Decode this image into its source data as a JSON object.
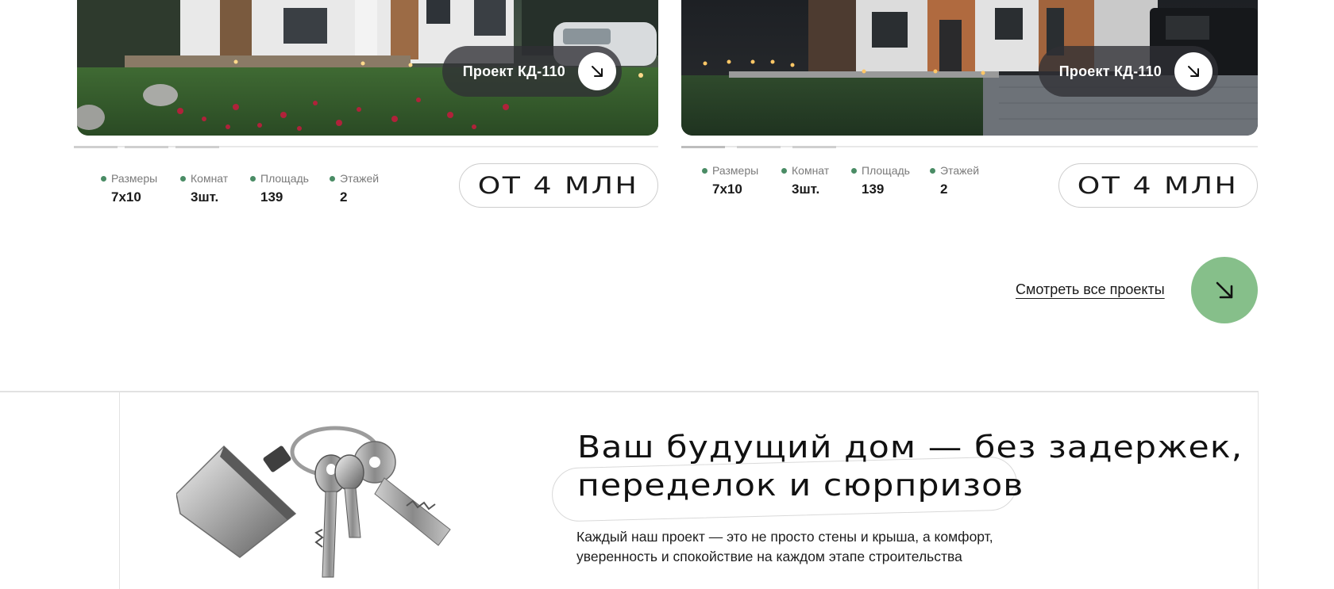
{
  "projects": [
    {
      "name": "Проект КД-110",
      "specs": [
        {
          "label": "Размеры",
          "value": "7x10"
        },
        {
          "label": "Комнат",
          "value": "3шт."
        },
        {
          "label": "Площадь",
          "value": "139"
        },
        {
          "label": "Этажей",
          "value": "2"
        }
      ],
      "price": "ОТ 4 МЛН"
    },
    {
      "name": "Проект КД-110",
      "specs": [
        {
          "label": "Размеры",
          "value": "7x10"
        },
        {
          "label": "Комнат",
          "value": "3шт."
        },
        {
          "label": "Площадь",
          "value": "139"
        },
        {
          "label": "Этажей",
          "value": "2"
        }
      ],
      "price": "ОТ 4 МЛН"
    }
  ],
  "view_all": {
    "label": "Смотреть все проекты",
    "icon": "arrow-down-right-icon"
  },
  "promo": {
    "headline_line1": "Ваш будущий дом — без задержек,",
    "headline_line2": "переделок и сюрпризов",
    "text_line1": "Каждый наш проект — это не просто стены и крыша, а комфорт,",
    "text_line2": "уверенность и спокойствие на каждом этапе строительства"
  },
  "colors": {
    "accent_green": "#86bf8a",
    "dot_green": "#4a8c65",
    "text": "#1a1a1a"
  }
}
